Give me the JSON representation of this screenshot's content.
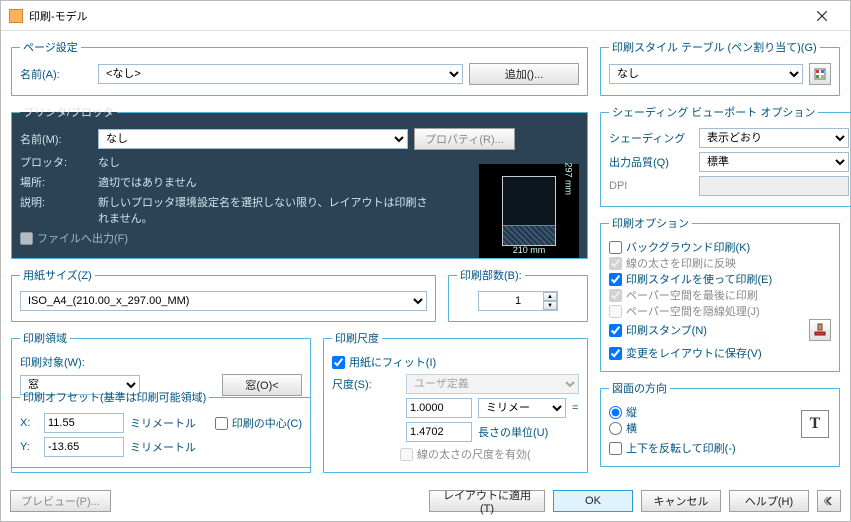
{
  "window": {
    "title": "印刷-モデル"
  },
  "page_setup": {
    "legend": "ページ設定",
    "name_label": "名前(A):",
    "name_value": "<なし>",
    "add_button": "追加()..."
  },
  "printer": {
    "legend": "プリンタ/プロッタ",
    "name_label": "名前(M):",
    "name_value": "なし",
    "properties_button": "プロパティ(R)...",
    "plotter_label": "プロッタ:",
    "plotter_value": "なし",
    "location_label": "場所:",
    "location_value": "適切ではありません",
    "desc_label": "説明:",
    "desc_value": "新しいプロッタ環境設定名を選択しない限り、レイアウトは印刷されません。",
    "to_file": "ファイルへ出力(F)",
    "preview_w": "210 mm",
    "preview_h": "297 mm"
  },
  "paper": {
    "legend": "用紙サイズ(Z)",
    "value": "ISO_A4_(210.00_x_297.00_MM)"
  },
  "copies": {
    "legend": "印刷部数(B):",
    "value": "1"
  },
  "area": {
    "legend": "印刷領域",
    "target_label": "印刷対象(W):",
    "target_value": "窓",
    "window_button": "窓(O)<"
  },
  "scale": {
    "legend": "印刷尺度",
    "fit": "用紙にフィット(I)",
    "scale_label": "尺度(S):",
    "scale_value": "ユーザ定義",
    "num": "1.0000",
    "unit": "ミリメートル",
    "eq": "=",
    "den": "1.4702",
    "unit_label": "長さの単位(U)",
    "lw_scale": "線の太さの尺度を有効("
  },
  "offset": {
    "legend": "印刷オフセット(基準は印刷可能領域)",
    "x_label": "X:",
    "x_value": "11.55",
    "y_label": "Y:",
    "y_value": "-13.65",
    "unit": "ミリメートル",
    "center": "印刷の中心(C)"
  },
  "styletable": {
    "legend": "印刷スタイル テーブル (ペン割り当て)(G)",
    "value": "なし"
  },
  "shading": {
    "legend": "シェーディング ビューポート オプション",
    "shade_label": "シェーディング",
    "shade_value": "表示どおり",
    "quality_label": "出力品質(Q)",
    "quality_value": "標準",
    "dpi_label": "DPI",
    "dpi_value": ""
  },
  "options": {
    "legend": "印刷オプション",
    "background": "バックグラウンド印刷(K)",
    "linew": "線の太さを印刷に反映",
    "styles": "印刷スタイルを使って印刷(E)",
    "ps_last": "ペーパー空間を最後に印刷",
    "ps_hidden": "ペーパー空間を隠線処理(J)",
    "stamp": "印刷スタンプ(N)",
    "save": "変更をレイアウトに保存(V)"
  },
  "orient": {
    "legend": "図面の方向",
    "portrait": "縦",
    "landscape": "横",
    "upside": "上下を反転して印刷(-)"
  },
  "footer": {
    "preview": "プレビュー(P)...",
    "apply": "レイアウトに適用(T)",
    "ok": "OK",
    "cancel": "キャンセル",
    "help": "ヘルプ(H)"
  }
}
